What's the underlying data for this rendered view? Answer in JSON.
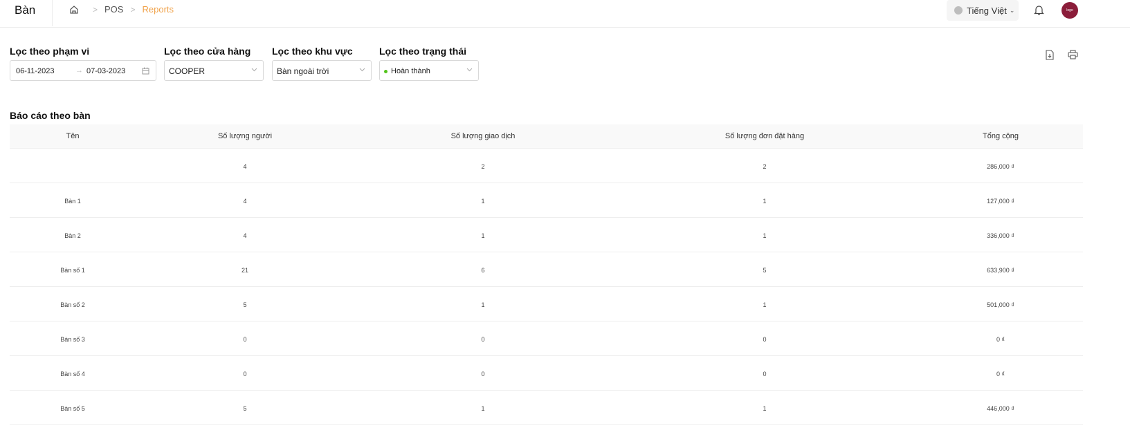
{
  "header": {
    "title": "Bàn",
    "breadcrumb": [
      "POS",
      "Reports"
    ],
    "language": "Tiếng Việt",
    "avatar_text": "logo"
  },
  "filters": {
    "range_label": "Lọc theo phạm vi",
    "date_from": "06-11-2023",
    "date_to": "07-03-2023",
    "store_label": "Lọc theo cửa hàng",
    "store_value": "COOPER",
    "area_label": "Lọc theo khu vực",
    "area_value": "Bàn ngoài trời",
    "status_label": "Lọc theo trạng thái",
    "status_value": "Hoàn thành",
    "status_color": "#52c41a"
  },
  "report": {
    "title": "Báo cáo theo bàn",
    "columns": [
      "Tên",
      "Số lượng người",
      "Số lượng giao dịch",
      "Số lượng đơn đặt hàng",
      "Tổng cộng"
    ],
    "rows": [
      [
        "",
        "4",
        "2",
        "2",
        "286,000 ₫"
      ],
      [
        "Bàn 1",
        "4",
        "1",
        "1",
        "127,000 ₫"
      ],
      [
        "Bàn 2",
        "4",
        "1",
        "1",
        "336,000 ₫"
      ],
      [
        "Bàn số 1",
        "21",
        "6",
        "5",
        "633,900 ₫"
      ],
      [
        "Bàn số 2",
        "5",
        "1",
        "1",
        "501,000 ₫"
      ],
      [
        "Bàn số 3",
        "0",
        "0",
        "0",
        "0 ₫"
      ],
      [
        "Bàn số 4",
        "0",
        "0",
        "0",
        "0 ₫"
      ],
      [
        "Bàn số 5",
        "5",
        "1",
        "1",
        "446,000 ₫"
      ]
    ]
  },
  "icons": {
    "home": "home-icon",
    "bell": "bell-icon",
    "globe": "globe-icon",
    "calendar": "calendar-icon",
    "export": "export-icon",
    "print": "print-icon"
  },
  "colors": {
    "accent": "#f0a24a",
    "avatar_bg": "#8b1d3a"
  }
}
